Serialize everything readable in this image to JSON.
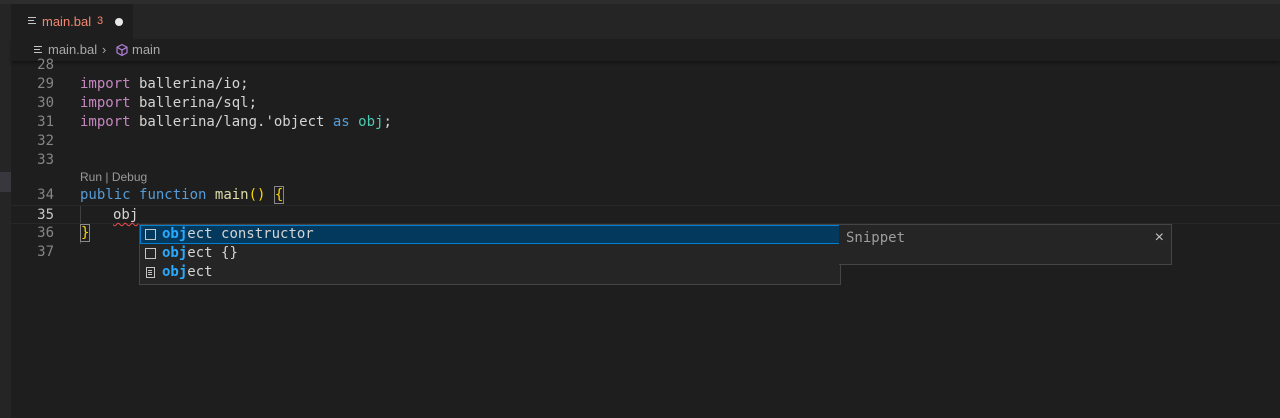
{
  "tab": {
    "filename": "main.bal",
    "problems": "3"
  },
  "breadcrumb": {
    "file": "main.bal",
    "separator": "›",
    "symbol": "main"
  },
  "editor": {
    "lines": [
      {
        "num": "28",
        "text": ""
      },
      {
        "num": "29",
        "tokens": [
          "import",
          " ballerina/io;"
        ]
      },
      {
        "num": "30",
        "tokens": [
          "import",
          " ballerina/sql;"
        ]
      },
      {
        "num": "31",
        "tokens": [
          "import",
          " ballerina/lang.'object ",
          "as",
          " ",
          "obj",
          ";"
        ]
      },
      {
        "num": "32",
        "text": ""
      },
      {
        "num": "33",
        "text": ""
      },
      {
        "num": "34",
        "tokens": [
          "public",
          " ",
          "function",
          " ",
          "main",
          "() ",
          "{"
        ]
      },
      {
        "num": "35",
        "text": "obj"
      },
      {
        "num": "36",
        "text": "}"
      },
      {
        "num": "37",
        "text": ""
      }
    ],
    "codelens": {
      "run": "Run",
      "separator": "|",
      "debug": "Debug"
    }
  },
  "suggest": {
    "items": [
      {
        "match": "obj",
        "rest": "ect constructor",
        "kind": "snippet",
        "selected": true
      },
      {
        "match": "obj",
        "rest": "ect {}",
        "kind": "snippet",
        "selected": false
      },
      {
        "match": "obj",
        "rest": "ect",
        "kind": "keyword",
        "selected": false
      }
    ],
    "details": {
      "label": "Snippet",
      "close": "×"
    }
  }
}
